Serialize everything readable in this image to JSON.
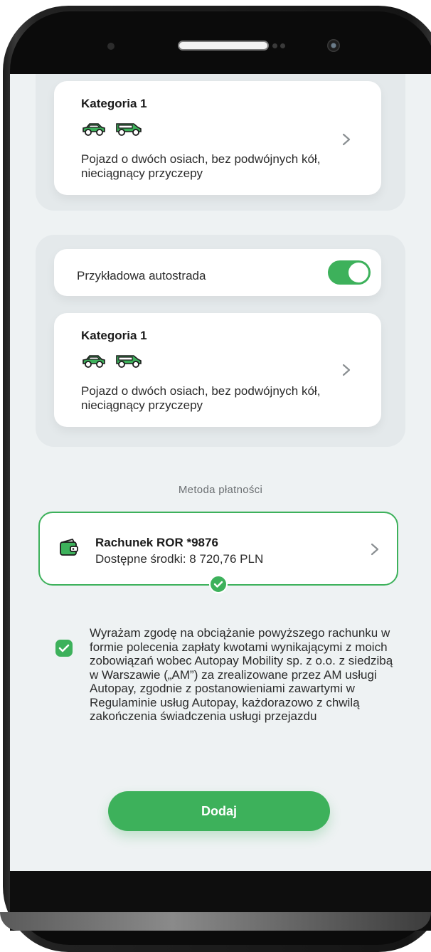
{
  "colors": {
    "accent": "#3db15b",
    "screen_background": "#eef2f3",
    "card_background": "#ffffff",
    "group_background": "#e4e9eb",
    "vehicle_icon": "#3db15b"
  },
  "tolls": [
    {
      "category": {
        "title": "Kategoria 1",
        "icons": [
          "car-icon",
          "van-icon"
        ],
        "description": "Pojazd o dwóch osiach, bez podwójnych kół, nieciągnący przyczepy"
      }
    },
    {
      "road": {
        "label": "Przykładowa autostrada",
        "enabled": true
      },
      "category": {
        "title": "Kategoria 1",
        "icons": [
          "car-icon",
          "van-icon"
        ],
        "description": "Pojazd o dwóch osiach, bez podwójnych kół, nieciągnący przyczepy"
      }
    }
  ],
  "payment": {
    "section_label": "Metoda płatności",
    "account_title": "Rachunek ROR *9876",
    "available_funds": "Dostępne środki: 8 720,76 PLN",
    "icon": "wallet-icon",
    "selected": true
  },
  "consent": {
    "checked": true,
    "text": "Wyrażam zgodę na obciążanie powyższego rachunku w formie polecenia zapłaty kwotami wynikającymi z moich zobowiązań wobec Autopay Mobility sp. z o.o. z siedzibą w Warszawie („AM”) za zrealizowane przez AM usługi Autopay, zgodnie z postanowieniami zawartymi w Regulaminie usług Autopay, każdorazowo z chwilą zakończenia świadczenia usługi przejazdu"
  },
  "actions": {
    "add_label": "Dodaj"
  }
}
